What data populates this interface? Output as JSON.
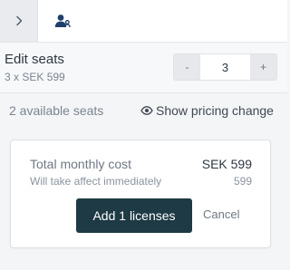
{
  "topbar": {
    "expand_icon": "chevron-right-icon",
    "user_icon": "user-group-icon",
    "accent": "#1f3f6b"
  },
  "seats": {
    "title": "Edit seats",
    "subtitle": "3 x SEK 599",
    "decrement_label": "-",
    "increment_label": "+",
    "quantity": "3"
  },
  "availability": {
    "available_text": "2 available seats",
    "pricing_link": "Show pricing change",
    "pricing_icon": "eye-icon"
  },
  "summary": {
    "total_label": "Total monthly cost",
    "total_value": "SEK 599",
    "note": "Will take affect immediately",
    "note_value": "599",
    "primary_action": "Add 1 licenses",
    "secondary_action": "Cancel",
    "primary_color": "#1e3a44"
  }
}
